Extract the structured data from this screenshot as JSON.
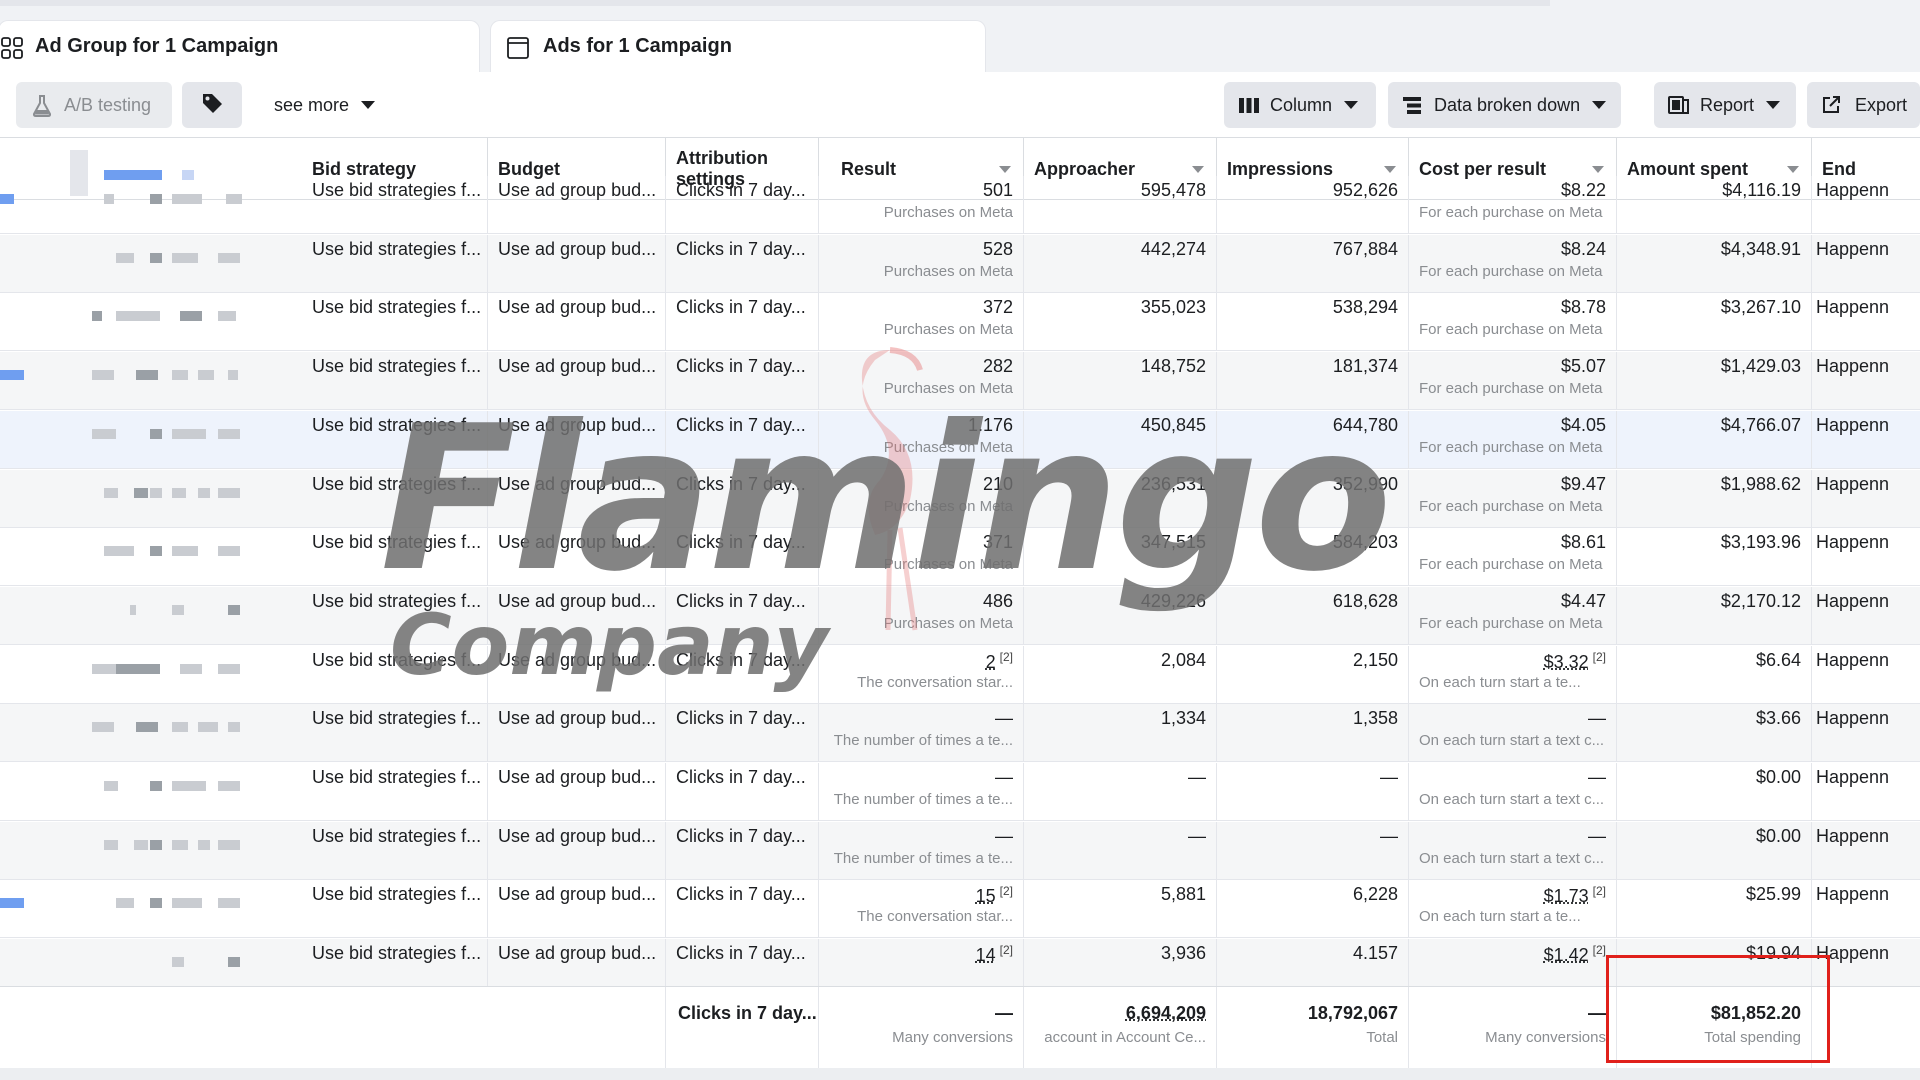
{
  "tabs": [
    {
      "label": "Ad Group for 1 Campaign",
      "icon": "grid-icon"
    },
    {
      "label": "Ads for 1 Campaign",
      "icon": "ad-icon"
    }
  ],
  "toolbar": {
    "ab_testing": "A/B testing",
    "see_more": "see more",
    "column": "Column",
    "breakdown": "Data broken down",
    "report": "Report",
    "export": "Export"
  },
  "columns": {
    "bid_strategy": "Bid strategy",
    "budget": "Budget",
    "attribution": "Attribution settings",
    "result": "Result",
    "approacher": "Approacher",
    "impressions": "Impressions",
    "cost_per_result": "Cost per result",
    "amount_spent": "Amount spent",
    "end": "End"
  },
  "rows": [
    {
      "bid": "Use bid strategies f...",
      "budget": "Use ad group bud...",
      "attr": "Clicks in 7 day...",
      "result": "501",
      "result_sub": "Purchases on Meta",
      "approacher": "595,478",
      "impressions": "952,626",
      "cpr": "$8.22",
      "cpr_sub": "For each purchase on Meta",
      "spent": "$4,116.19",
      "end": "Happenn"
    },
    {
      "bid": "Use bid strategies f...",
      "budget": "Use ad group bud...",
      "attr": "Clicks in 7 day...",
      "result": "528",
      "result_sub": "Purchases on Meta",
      "approacher": "442,274",
      "impressions": "767,884",
      "cpr": "$8.24",
      "cpr_sub": "For each purchase on Meta",
      "spent": "$4,348.91",
      "end": "Happenn"
    },
    {
      "bid": "Use bid strategies f...",
      "budget": "Use ad group bud...",
      "attr": "Clicks in 7 day...",
      "result": "372",
      "result_sub": "Purchases on Meta",
      "approacher": "355,023",
      "impressions": "538,294",
      "cpr": "$8.78",
      "cpr_sub": "For each purchase on Meta",
      "spent": "$3,267.10",
      "end": "Happenn"
    },
    {
      "bid": "Use bid strategies f...",
      "budget": "Use ad group bud...",
      "attr": "Clicks in 7 day...",
      "result": "282",
      "result_sub": "Purchases on Meta",
      "approacher": "148,752",
      "impressions": "181,374",
      "cpr": "$5.07",
      "cpr_sub": "For each purchase on Meta",
      "spent": "$1,429.03",
      "end": "Happenn"
    },
    {
      "bid": "Use bid strategies f...",
      "budget": "Use ad group bud...",
      "attr": "Clicks in 7 day...",
      "result": "1.176",
      "result_sub": "Purchases on Meta",
      "approacher": "450,845",
      "impressions": "644,780",
      "cpr": "$4.05",
      "cpr_sub": "For each purchase on Meta",
      "spent": "$4,766.07",
      "end": "Happenn"
    },
    {
      "bid": "Use bid strategies f...",
      "budget": "Use ad group bud...",
      "attr": "Clicks in 7 day...",
      "result": "210",
      "result_sub": "Purchases on Meta",
      "approacher": "236,531",
      "impressions": "352,990",
      "cpr": "$9.47",
      "cpr_sub": "For each purchase on Meta",
      "spent": "$1,988.62",
      "end": "Happenn"
    },
    {
      "bid": "Use bid strategies f...",
      "budget": "Use ad group bud...",
      "attr": "Clicks in 7 day...",
      "result": "371",
      "result_sub": "Purchases on Meta",
      "approacher": "347,515",
      "impressions": "584,203",
      "cpr": "$8.61",
      "cpr_sub": "For each purchase on Meta",
      "spent": "$3,193.96",
      "end": "Happenn"
    },
    {
      "bid": "Use bid strategies f...",
      "budget": "Use ad group bud...",
      "attr": "Clicks in 7 day...",
      "result": "486",
      "result_sub": "Purchases on Meta",
      "approacher": "429,226",
      "impressions": "618,628",
      "cpr": "$4.47",
      "cpr_sub": "For each purchase on Meta",
      "spent": "$2,170.12",
      "end": "Happenn"
    },
    {
      "bid": "Use bid strategies f...",
      "budget": "Use ad group bud...",
      "attr": "Clicks in 7 day...",
      "result": "2",
      "result_sup": "[2]",
      "result_sub": "The conversation star...",
      "approacher": "2,084",
      "impressions": "2,150",
      "cpr": "$3.32",
      "cpr_sup": "[2]",
      "cpr_sub": "On each turn start a te...",
      "spent": "$6.64",
      "end": "Happenn"
    },
    {
      "bid": "Use bid strategies f...",
      "budget": "Use ad group bud...",
      "attr": "Clicks in 7 day...",
      "result": "—",
      "result_sub": "The number of times a te...",
      "approacher": "1,334",
      "impressions": "1,358",
      "cpr": "—",
      "cpr_sub": "On each turn start a text c...",
      "spent": "$3.66",
      "end": "Happenn"
    },
    {
      "bid": "Use bid strategies f...",
      "budget": "Use ad group bud...",
      "attr": "Clicks in 7 day...",
      "result": "—",
      "result_sub": "The number of times a te...",
      "approacher": "—",
      "impressions": "—",
      "cpr": "—",
      "cpr_sub": "On each turn start a text c...",
      "spent": "$0.00",
      "end": "Happenn"
    },
    {
      "bid": "Use bid strategies f...",
      "budget": "Use ad group bud...",
      "attr": "Clicks in 7 day...",
      "result": "—",
      "result_sub": "The number of times a te...",
      "approacher": "—",
      "impressions": "—",
      "cpr": "—",
      "cpr_sub": "On each turn start a text c...",
      "spent": "$0.00",
      "end": "Happenn"
    },
    {
      "bid": "Use bid strategies f...",
      "budget": "Use ad group bud...",
      "attr": "Clicks in 7 day...",
      "result": "15",
      "result_sup": "[2]",
      "result_sub": "The conversation star...",
      "approacher": "5,881",
      "impressions": "6,228",
      "cpr": "$1.73",
      "cpr_sup": "[2]",
      "cpr_sub": "On each turn start a te...",
      "spent": "$25.99",
      "end": "Happenn"
    },
    {
      "bid": "Use bid strategies f...",
      "budget": "Use ad group bud...",
      "attr": "Clicks in 7 day...",
      "result": "14",
      "result_sup": "[2]",
      "result_sub": "",
      "approacher": "3,936",
      "impressions": "4.157",
      "cpr": "$1.42",
      "cpr_sup": "[2]",
      "cpr_sub": "",
      "spent": "$19.94",
      "end": "Happenn"
    }
  ],
  "totals": {
    "attr": "Clicks in 7 day...",
    "result": "—",
    "result_sub": "Many conversions",
    "approacher": "6,694,209",
    "approacher_sub": "account in Account Ce...",
    "impressions": "18,792,067",
    "impressions_sub": "Total",
    "cpr": "—",
    "cpr_sub": "Many conversions",
    "spent": "$81,852.20",
    "spent_sub": "Total spending"
  },
  "watermark": {
    "line1": "Flamingo",
    "line2": "Company"
  },
  "colors": {
    "highlight_box": "#e0201b",
    "accent_blue": "#1877f2"
  }
}
